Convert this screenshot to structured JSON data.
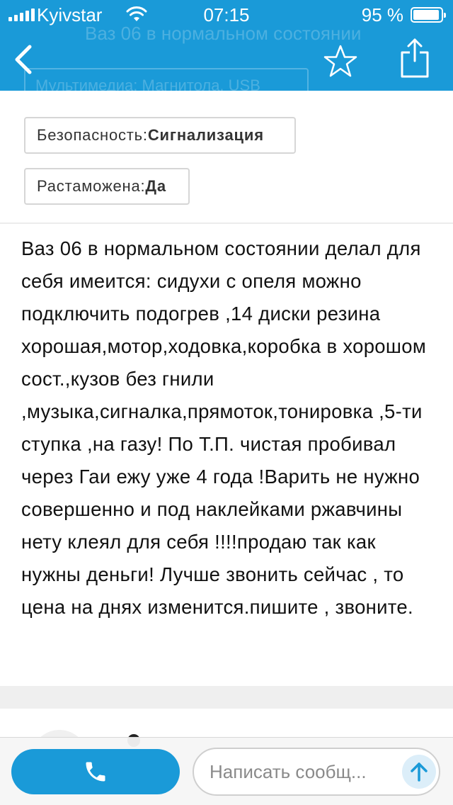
{
  "status_bar": {
    "carrier": "Kyivstar",
    "time": "07:15",
    "battery_percent": "95 %",
    "battery_level": 0.95
  },
  "header": {
    "faded_title": "Ваз 06 в нормальном состоянии",
    "faded_chip": "Мультимедиа: Магнитола, USB",
    "back_icon": "chevron-left-icon",
    "favorite_icon": "star-outline-icon",
    "share_icon": "share-icon"
  },
  "params": [
    {
      "label": "Безопасность: ",
      "value": "Сигнализация"
    },
    {
      "label": "Растаможена: ",
      "value": "Да"
    }
  ],
  "description": "Ваз 06 в нормальном состоянии делал для себя имеится: сидухи с опеля можно подключить подогрев ,14 диски резина хорошая,мотор,ходовка,коробка в хорошом сост.,кузов без гнили ,музыка,сигналка,прямоток,тонировка ,5-ти ступка ,на газу! По Т.П. чистая пробивал через Гаи ежу уже 4 года !Варить не нужно совершенно и под наклейками ржавчины нету клеял для себя !!!!продаю так как нужны деньги! Лучше звонить сейчас , то цена на днях изменится.пишите , звоните.",
  "bottom_bar": {
    "call_icon": "phone-icon",
    "message_placeholder": "Написать сообщ...",
    "send_icon": "arrow-up-icon"
  },
  "colors": {
    "accent": "#1a9ad8",
    "chip_border": "#d6d6d6",
    "band": "#efefef"
  }
}
